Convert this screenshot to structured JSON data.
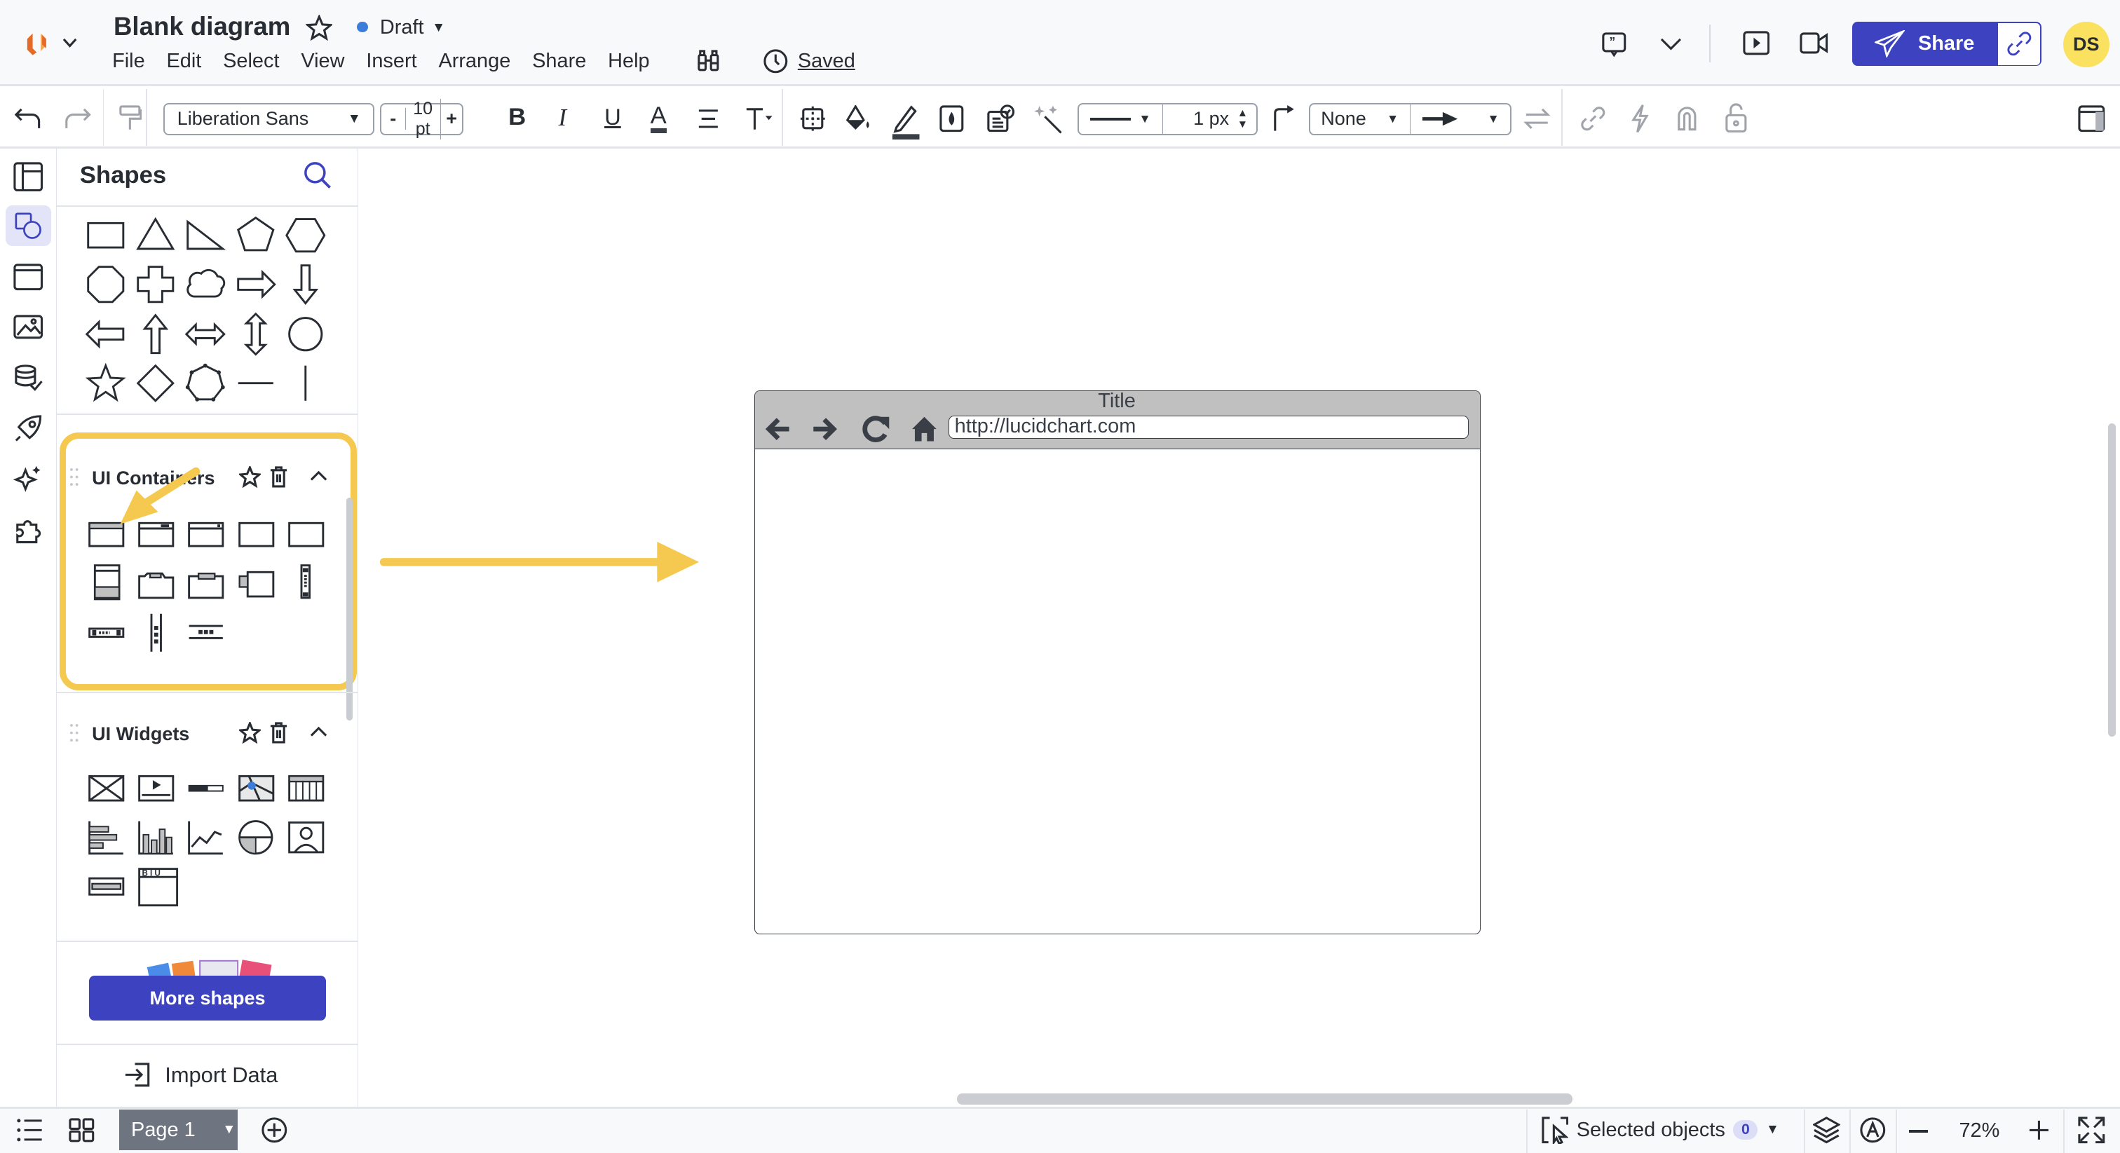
{
  "header": {
    "doc_title": "Blank diagram",
    "status": "Draft",
    "status_color": "#3b7dd8",
    "menu": [
      "File",
      "Edit",
      "Select",
      "View",
      "Insert",
      "Arrange",
      "Share",
      "Help"
    ],
    "saved": "Saved",
    "share_label": "Share",
    "avatar_initials": "DS",
    "accent": "#3d43c0",
    "avatar_color": "#fbe160"
  },
  "toolbar": {
    "font": "Liberation Sans",
    "font_size": "10 pt",
    "minus": "-",
    "plus": "+",
    "bold": "B",
    "italic": "I",
    "underline": "U",
    "text_color": "A",
    "line_width": "1 px",
    "line_end": "None"
  },
  "panel": {
    "title": "Shapes",
    "basic_shapes": [
      "rectangle",
      "triangle",
      "right-triangle",
      "pentagon",
      "hexagon",
      "octagon",
      "cross",
      "cloud",
      "arrow-right",
      "arrow-down",
      "arrow-left",
      "arrow-up",
      "arrow-left-right",
      "arrow-up-down",
      "circle",
      "star",
      "diamond",
      "polygon",
      "horizontal-line",
      "vertical-line"
    ],
    "sections": [
      {
        "title": "UI Containers",
        "shapes": [
          "browser-window",
          "app-window",
          "dialog-window",
          "panel",
          "container",
          "mobile-panel",
          "folder-tabs",
          "tabbed-container",
          "vertical-tabs",
          "vertical-toolbar",
          "horizontal-toolbar",
          "vertical-separator",
          "horizontal-separator"
        ]
      },
      {
        "title": "UI Widgets",
        "shapes": [
          "image-placeholder",
          "video-player",
          "progress-bar",
          "map",
          "table",
          "bar-chart-horizontal",
          "bar-chart",
          "line-chart",
          "pie-chart",
          "user-image",
          "text-input",
          "rich-text-editor"
        ]
      }
    ],
    "more_shapes": "More shapes",
    "import_data": "Import Data",
    "highlight_color": "#f5c94f"
  },
  "canvas": {
    "browser_title": "Title",
    "browser_url": "http://lucidchart.com"
  },
  "bottom": {
    "page": "Page 1",
    "selected_label": "Selected objects",
    "selected_count": "0",
    "zoom": "72%"
  }
}
